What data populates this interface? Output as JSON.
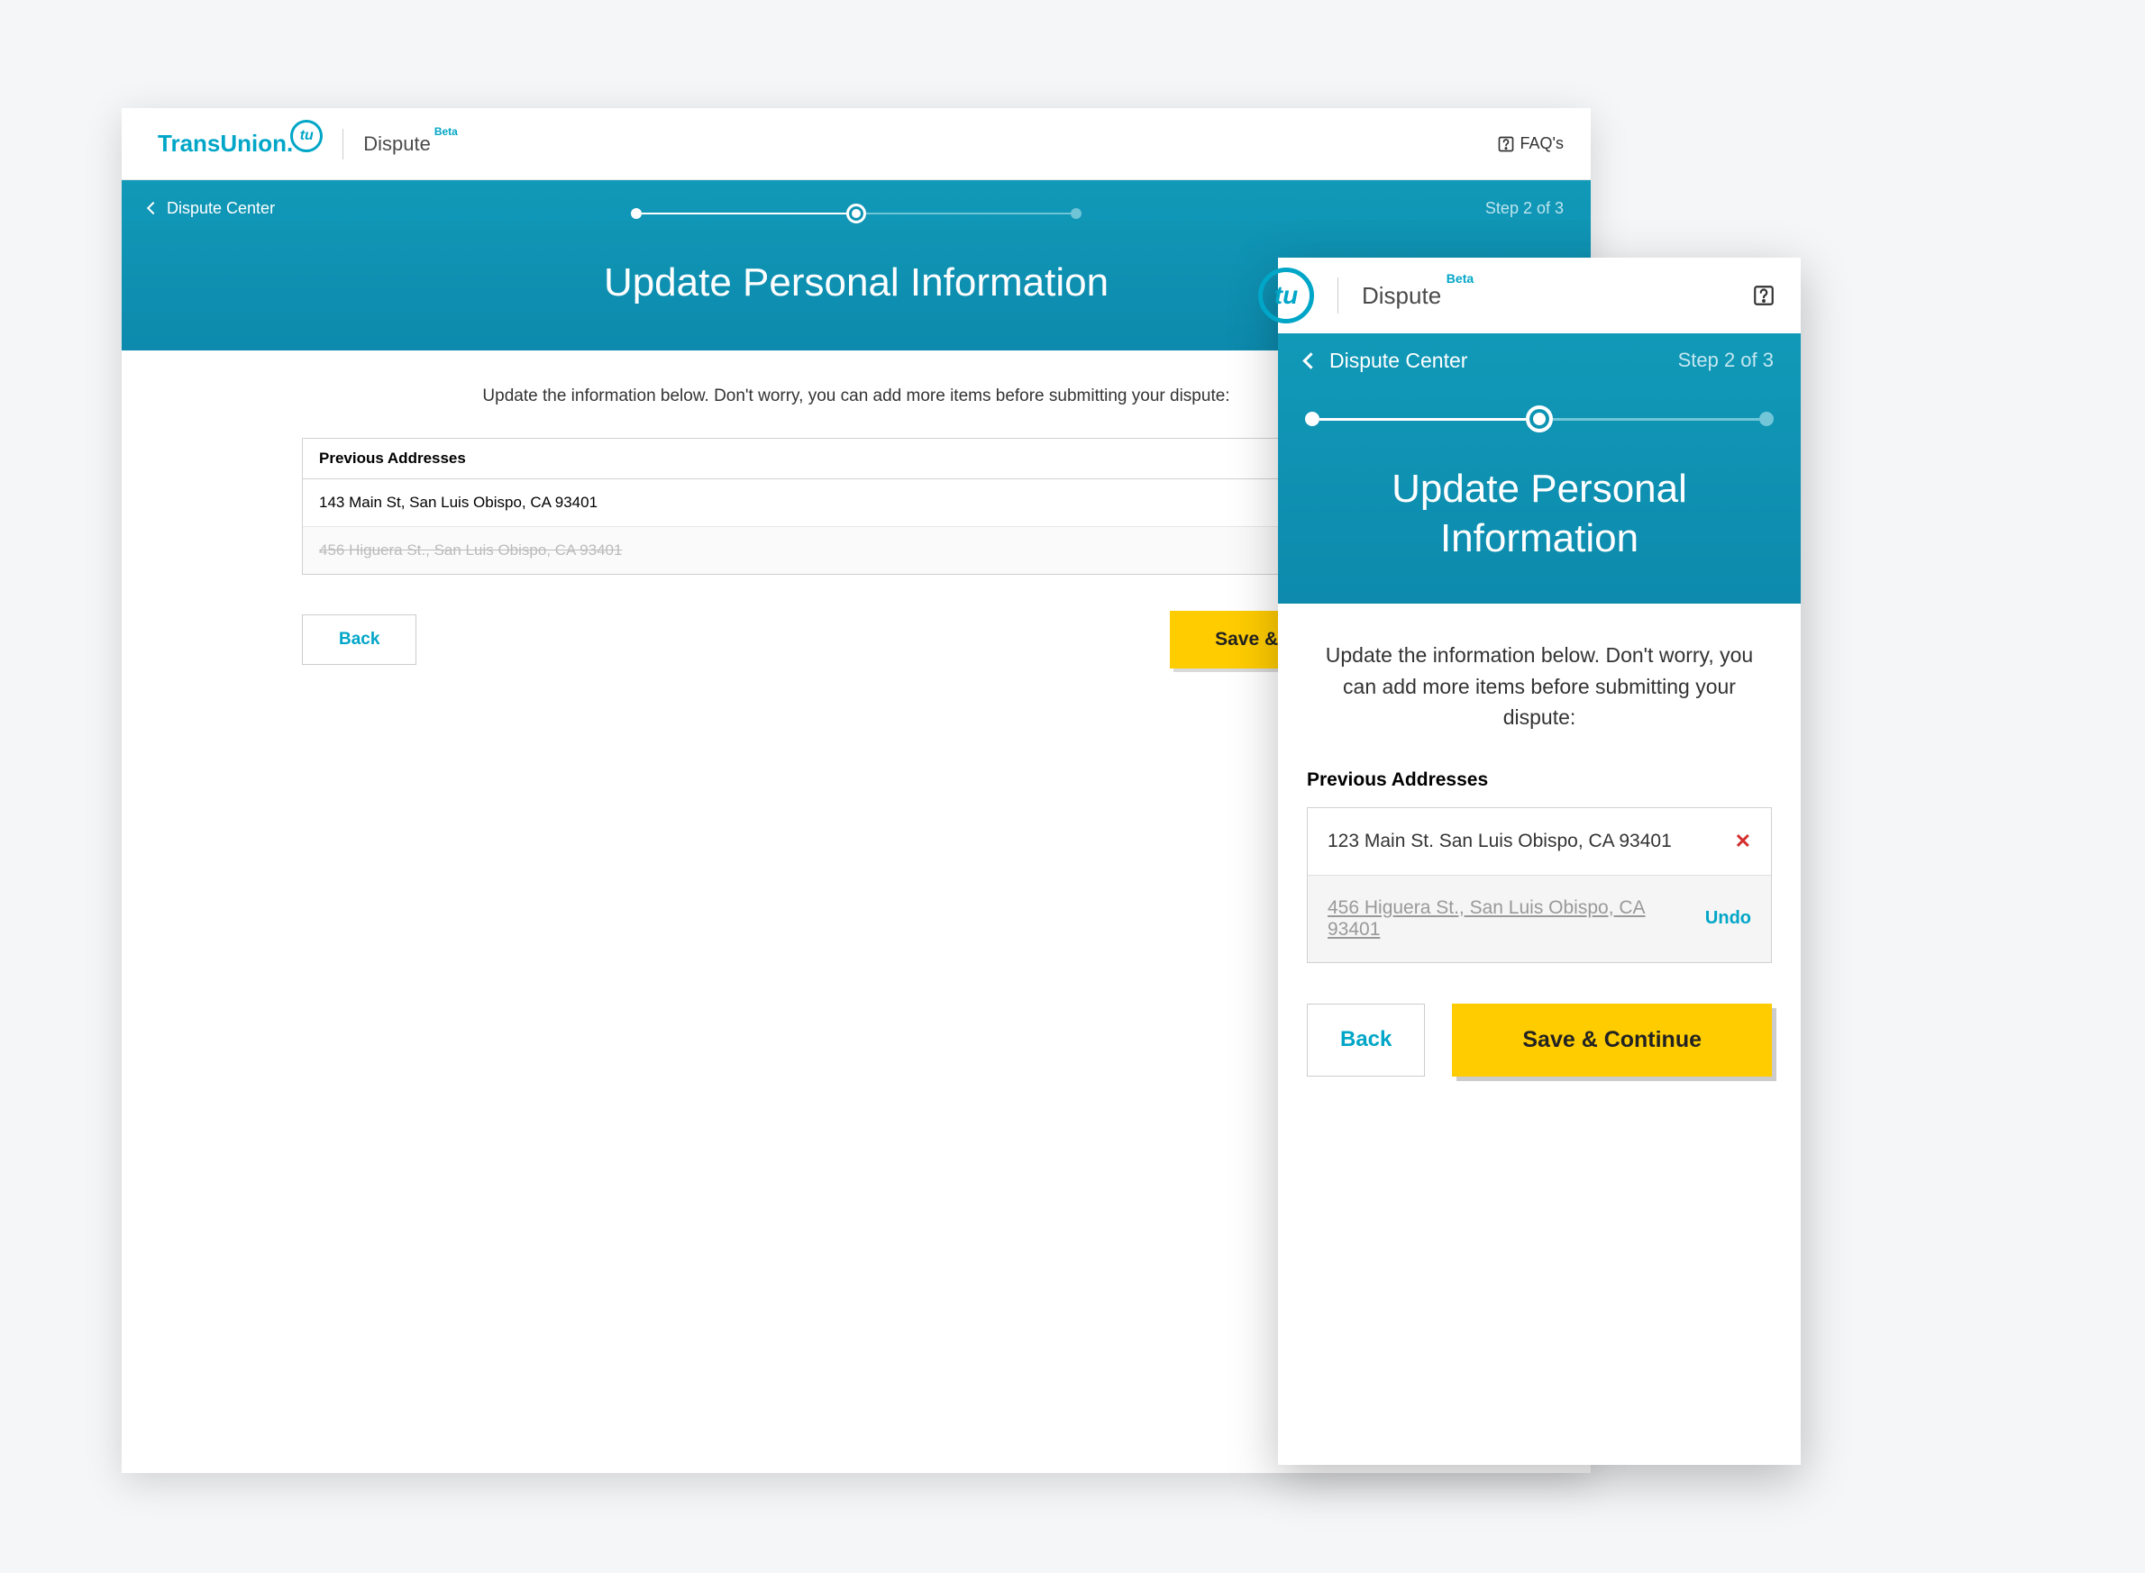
{
  "brand": {
    "name": "TransUnion",
    "mark": "tu",
    "product": "Dispute",
    "badge": "Beta"
  },
  "topnav": {
    "faqs": "FAQ's"
  },
  "breadcrumb": {
    "label": "Dispute Center"
  },
  "step": {
    "text": "Step 2 of 3"
  },
  "page": {
    "title": "Update Personal Information",
    "intro_desktop": "Update the information below. Don't worry, you can add more items before submitting your dispute:",
    "intro_mobile": "Update the information below. Don't worry, you can add more items before submitting your dispute:"
  },
  "section": {
    "previous_addresses": "Previous Addresses"
  },
  "desktop_addresses": [
    {
      "text": "143 Main St, San Luis Obispo, CA 93401",
      "removed": false
    },
    {
      "text": "456 Higuera St., San Luis Obispo, CA 93401",
      "removed": true
    }
  ],
  "mobile_addresses": [
    {
      "text": "123 Main St. San Luis Obispo, CA 93401",
      "removed": false
    },
    {
      "text": "456 Higuera St., San Luis Obispo, CA 93401",
      "removed": true
    }
  ],
  "actions": {
    "back": "Back",
    "save": "Save & Continue",
    "undo": "Undo"
  }
}
